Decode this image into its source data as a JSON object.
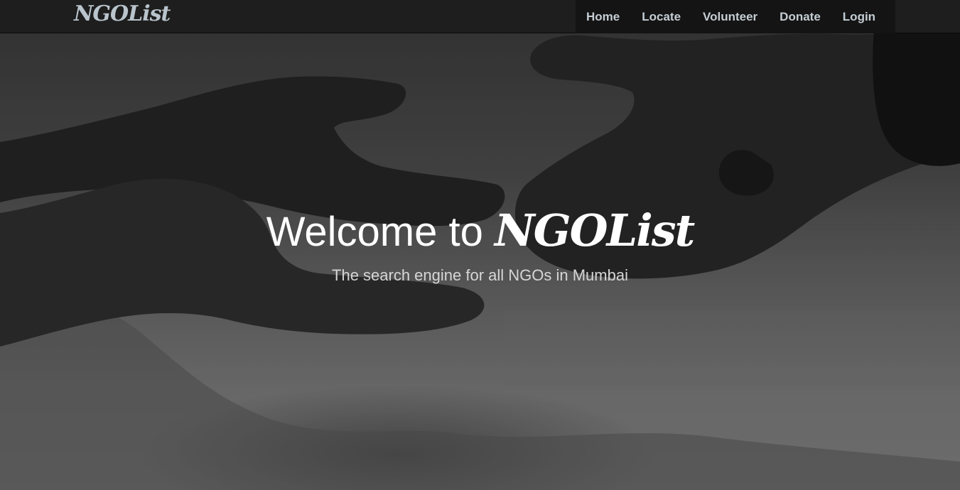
{
  "navbar": {
    "brand": "NGOList",
    "links": [
      {
        "label": "Home"
      },
      {
        "label": "Locate"
      },
      {
        "label": "Volunteer"
      },
      {
        "label": "Donate"
      },
      {
        "label": "Login"
      }
    ]
  },
  "hero": {
    "title_prefix": "Welcome to ",
    "title_brand": "NGOList",
    "subtitle": "The search engine for all NGOs in Mumbai"
  },
  "colors": {
    "navbar_bg": "#1e1e1e",
    "nav_link": "#c4cdd3",
    "hero_text": "#ffffff"
  }
}
